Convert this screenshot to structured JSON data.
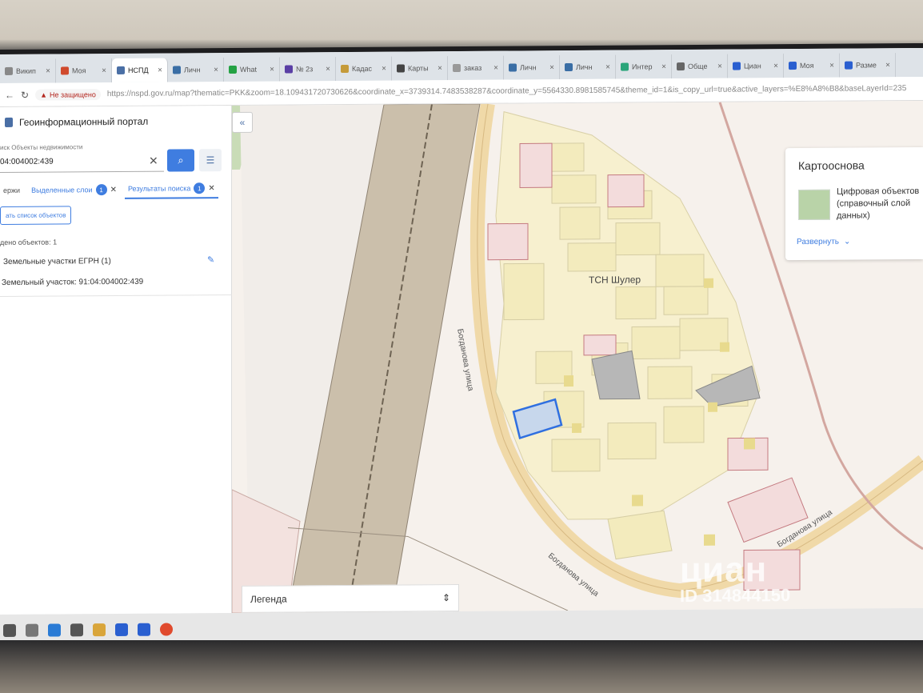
{
  "browser": {
    "tabs": [
      {
        "label": "Викип",
        "color": "#888"
      },
      {
        "label": "Моя",
        "color": "#d04a2d"
      },
      {
        "label": "НСПД",
        "color": "#4a6fa5",
        "active": true
      },
      {
        "label": "Личн",
        "color": "#3a6ea5"
      },
      {
        "label": "What",
        "color": "#25a244"
      },
      {
        "label": "№ 2з",
        "color": "#5a3fa5"
      },
      {
        "label": "Кадас",
        "color": "#c59b3a"
      },
      {
        "label": "Карты",
        "color": "#444"
      },
      {
        "label": "заказ",
        "color": "#999"
      },
      {
        "label": "Личн",
        "color": "#3a6ea5"
      },
      {
        "label": "Личн",
        "color": "#3a6ea5"
      },
      {
        "label": "Интер",
        "color": "#2aa57a"
      },
      {
        "label": "Обще",
        "color": "#666"
      },
      {
        "label": "Циан",
        "color": "#2a5fd0"
      },
      {
        "label": "Моя",
        "color": "#2a5fd0"
      },
      {
        "label": "Разме",
        "color": "#2a5fd0"
      }
    ],
    "security_label": "Не защищено",
    "url": "https://nspd.gov.ru/map?thematic=PKK&zoom=18.109431720730626&coordinate_x=3739314.7483538287&coordinate_y=5564330.8981585745&theme_id=1&is_copy_url=true&active_layers=%E8%A8%B8&baseLayerId=235"
  },
  "sidebar": {
    "portal_title": "Геоинформационный портал",
    "search_label": "иск Объекты недвижимости",
    "search_value": "04:004002:439",
    "tabs": [
      {
        "label": "ержи",
        "type": "plain"
      },
      {
        "label": "Выделенные слои",
        "badge": "1",
        "type": "link"
      },
      {
        "label": "Результаты поиска",
        "badge": "1",
        "type": "active"
      }
    ],
    "clear_list_label": "ать список объектов",
    "found_count": "дено объектов: 1",
    "group_title": "Земельные участки ЕГРН (1)",
    "result_item": "Земельный участок: 91:04:004002:439"
  },
  "map": {
    "basemap_title": "Картооснова",
    "basemap_name": "Цифровая объектов (справочный слой данных)",
    "basemap_expand": "Развернуть",
    "legend_label": "Легенда",
    "area_label": "ТСН Шулер",
    "road_labels": [
      "Богданова улица",
      "Богданова улица",
      "Богданова улица"
    ],
    "watermark_logo": "циан",
    "watermark_id": "ID 314844150"
  },
  "colors": {
    "accent": "#3f7de0",
    "selected_parcel": "#2f6fe0",
    "parcel_fill": "#f4eec6",
    "road": "#f0d9a8"
  }
}
